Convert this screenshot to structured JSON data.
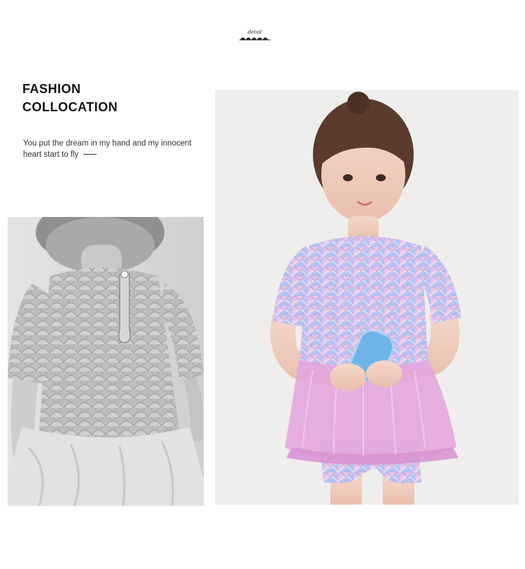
{
  "detail_label": "detail",
  "heading": {
    "line1": "FASHION",
    "line2": "COLLOCATION"
  },
  "tagline": {
    "text": "You put the dream in my hand and my innocent heart start to fly"
  },
  "photos": {
    "back_view": {
      "icon": "grayscale-back-view-photo",
      "tone": "#d9d9d9"
    },
    "front_view": {
      "icon": "child-mermaid-swimsuit-photo",
      "tone": "#efeeec"
    }
  },
  "colors": {
    "text": "#111111",
    "pink_tulle": "#e3a6dd",
    "iridescent": "#b9a6e4",
    "popsicle": "#6fb4e6"
  }
}
